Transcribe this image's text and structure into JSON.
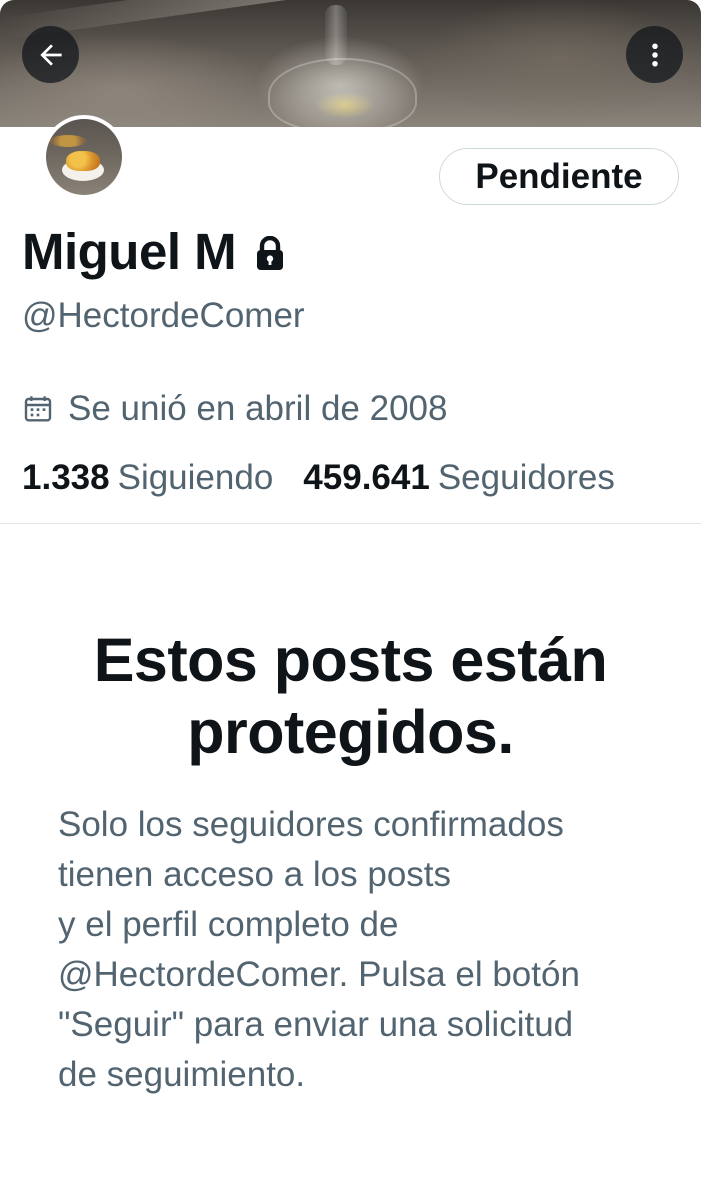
{
  "header": {
    "back_icon": "arrow-left-icon",
    "more_icon": "more-vertical-icon"
  },
  "profile": {
    "display_name": "Miguel M",
    "protected_icon": "lock-icon",
    "handle": "@HectordeComer",
    "follow_button_label": "Pendiente",
    "joined_icon": "calendar-icon",
    "joined_text": "Se unió en abril de 2008",
    "following_count": "1.338",
    "following_label": "Siguiendo",
    "followers_count": "459.641",
    "followers_label": "Seguidores"
  },
  "protected_notice": {
    "title_line1": "Estos posts están",
    "title_line2": "protegidos.",
    "body_lines": [
      "Solo los seguidores confirmados",
      "tienen acceso a los posts",
      "y el perfil completo de",
      "@HectordeComer. Pulsa el botón",
      "\"Seguir\" para enviar una solicitud",
      "de seguimiento."
    ]
  },
  "colors": {
    "primary_text": "#0f1419",
    "secondary_text": "#536471",
    "border": "#cfd9de"
  }
}
